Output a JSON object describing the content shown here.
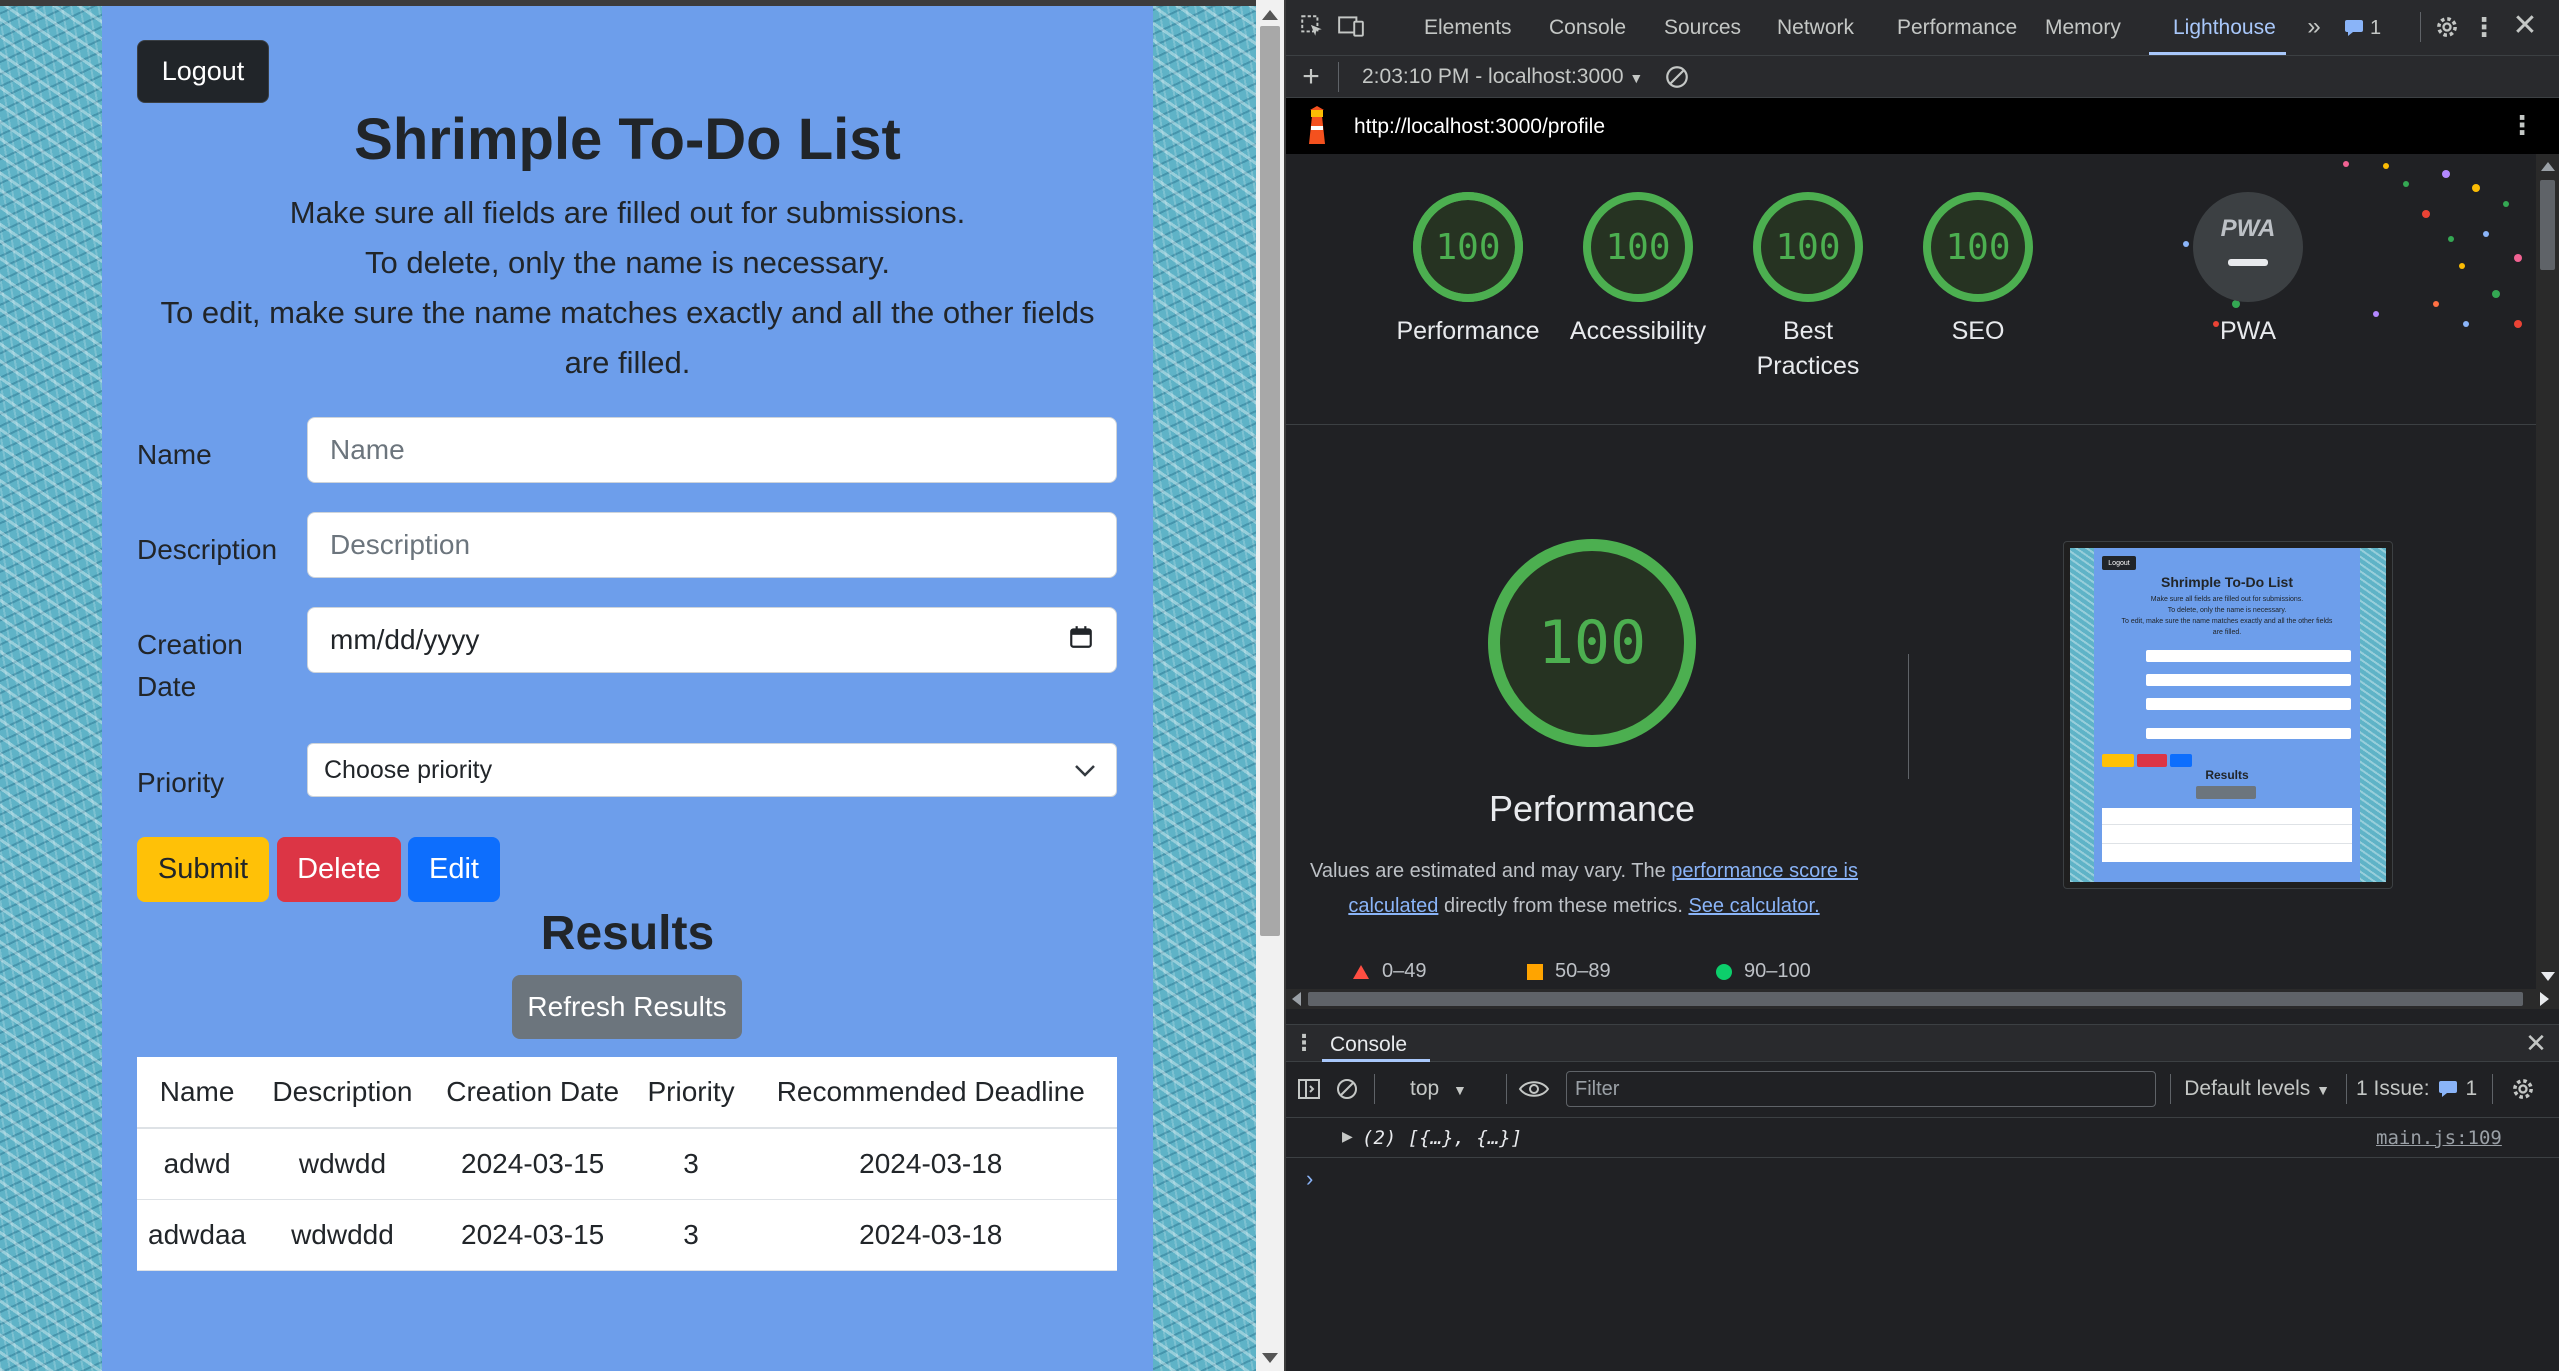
{
  "app": {
    "logout_label": "Logout",
    "title": "Shrimple To-Do List",
    "instructions": [
      "Make sure all fields are filled out for submissions.",
      "To delete, only the name is necessary.",
      "To edit, make sure the name matches exactly and all the other fields",
      "are filled."
    ],
    "form": {
      "name_label": "Name",
      "name_placeholder": "Name",
      "description_label": "Description",
      "description_placeholder": "Description",
      "creation_date_label_1": "Creation",
      "creation_date_label_2": "Date",
      "creation_date_value": "mm/dd/yyyy",
      "priority_label": "Priority",
      "priority_selected": "Choose priority"
    },
    "buttons": {
      "submit": "Submit",
      "delete": "Delete",
      "edit": "Edit",
      "refresh": "Refresh Results"
    },
    "results_title": "Results",
    "table": {
      "headers": [
        "Name",
        "Description",
        "Creation Date",
        "Priority",
        "Recommended Deadline"
      ],
      "rows": [
        [
          "adwd",
          "wdwdd",
          "2024-03-15",
          "3",
          "2024-03-18"
        ],
        [
          "adwdaa",
          "wdwddd",
          "2024-03-15",
          "3",
          "2024-03-18"
        ]
      ]
    },
    "colors": {
      "panel_bg": "#6d9eeb",
      "submit": "#ffc107",
      "delete": "#dc3545",
      "edit": "#0d6efd",
      "refresh": "#6c757d",
      "logout": "#212529"
    }
  },
  "devtools": {
    "tabs": [
      "Elements",
      "Console",
      "Sources",
      "Network",
      "Performance",
      "Memory",
      "Lighthouse"
    ],
    "active_tab": "Lighthouse",
    "issues_count": "1",
    "report_selector": "2:03:10 PM - localhost:3000",
    "url": "http://localhost:3000/profile",
    "scores": [
      {
        "label": "Performance",
        "value": "100"
      },
      {
        "label": "Accessibility",
        "value": "100"
      },
      {
        "label": "Best Practices",
        "value": "100"
      },
      {
        "label": "SEO",
        "value": "100"
      }
    ],
    "pwa_label": "PWA",
    "pwa_badge": "PWA",
    "main_score": "100",
    "main_label": "Performance",
    "desc_part1": "Values are estimated and may vary. The ",
    "desc_link1": "performance score is calculated",
    "desc_part2": " directly from these metrics. ",
    "desc_link2": "See calculator.",
    "legend": [
      "0–49",
      "50–89",
      "90–100"
    ],
    "thumbnail": {
      "title": "Shrimple To-Do List",
      "results": "Results",
      "logout": "Logout",
      "instr1": "Make sure all fields are filled out for submissions.",
      "instr2": "To delete, only the name is necessary.",
      "instr3": "To edit, make sure the name matches exactly and all the other fields",
      "instr4": "are filled."
    },
    "console": {
      "drawer_tab": "Console",
      "context": "top",
      "filter_placeholder": "Filter",
      "levels": "Default levels",
      "issues_label": "1 Issue:",
      "issues_count": "1",
      "log_text": "(2) [{…}, {…}]",
      "log_source": "main.js:109"
    },
    "colors": {
      "score_green": "#0cce6b",
      "fail_red": "#ff4e42",
      "avg_orange": "#ffa400",
      "link": "#8ab4f8",
      "accent": "#a8c7fa"
    }
  }
}
